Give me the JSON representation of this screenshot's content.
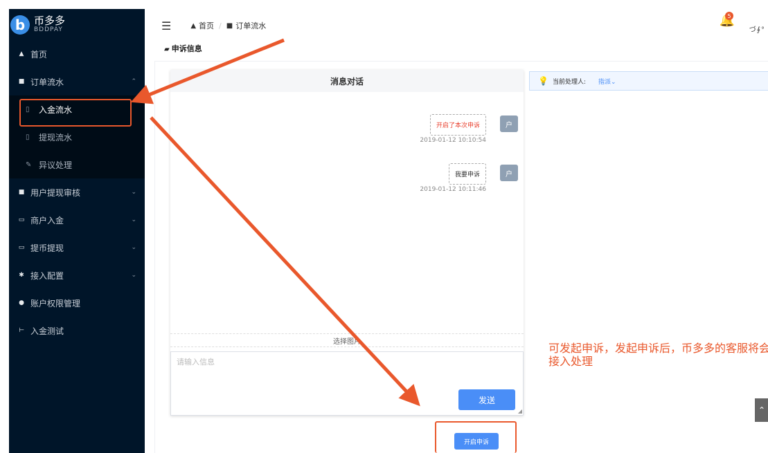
{
  "app": {
    "brand": "币多多",
    "brand_sub": "BDDPAY",
    "logo_glyph": "b"
  },
  "sidebar": {
    "items": [
      {
        "label": "首页",
        "icon": "home-icon"
      },
      {
        "label": "订单流水",
        "icon": "document-icon",
        "expanded": true,
        "children": [
          {
            "label": "入金流水",
            "icon": "file-icon",
            "active": true
          },
          {
            "label": "提现流水",
            "icon": "file-icon"
          },
          {
            "label": "异议处理",
            "icon": "edit-icon"
          }
        ]
      },
      {
        "label": "用户提现审核",
        "icon": "document-icon"
      },
      {
        "label": "商户入金",
        "icon": "card-icon"
      },
      {
        "label": "提币提现",
        "icon": "card-icon"
      },
      {
        "label": "接入配置",
        "icon": "gear-icon"
      },
      {
        "label": "账户权限管理",
        "icon": "user-icon"
      },
      {
        "label": "入金测试",
        "icon": "test-icon"
      }
    ]
  },
  "header": {
    "breadcrumb": [
      "首页",
      "订单流水"
    ],
    "notification_count": "5",
    "user": "づ∮°"
  },
  "section_title": "申诉信息",
  "chat": {
    "title": "消息对话",
    "messages": [
      {
        "text": "开启了本次申诉",
        "time": "2019-01-12 10:10:54",
        "avatar": "户",
        "color": "#e9412f"
      },
      {
        "text": "我要申诉",
        "time": "2019-01-12 10:11:46",
        "avatar": "户",
        "color": "#333333"
      }
    ],
    "image_select": "选择图片",
    "input_placeholder": "请输入信息",
    "send_label": "发送"
  },
  "open_appeal_label": "开启申诉",
  "handler": {
    "label": "当前处理人:",
    "value": "指派",
    "caret": "⌄"
  },
  "annotation_note": "可发起申诉，发起申诉后，币多多的客服将会接入处理",
  "accent_color": "#e9582c"
}
